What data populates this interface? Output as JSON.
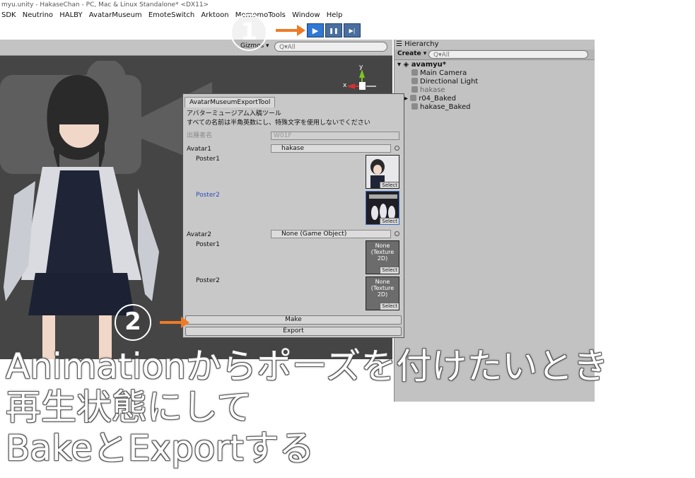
{
  "window": {
    "title": "myu.unity - HakaseChan - PC, Mac & Linux Standalone* <DX11>"
  },
  "menu": [
    "SDK",
    "Neutrino",
    "HALBY",
    "AvatarMuseum",
    "EmoteSwitch",
    "Arktoon",
    "MomomoTools",
    "Window",
    "Help"
  ],
  "playbar": {
    "play_icon": "play-icon",
    "pause_icon": "pause-icon",
    "step_icon": "step-icon",
    "play_glyph": "▶",
    "pause_glyph": "❚❚",
    "step_glyph": "▶|"
  },
  "scene": {
    "gizmos_label": "Gizmos ▾",
    "search_placeholder": "Q▾All",
    "axis_y": "y",
    "axis_x": "x"
  },
  "hierarchy": {
    "tab_label": "Hierarchy",
    "create_label": "Create ▾",
    "search_placeholder": "Q▾All",
    "scene_name": "avamyu*",
    "items": [
      {
        "label": "Main Camera",
        "active": true
      },
      {
        "label": "Directional Light",
        "active": true
      },
      {
        "label": "hakase",
        "active": false
      },
      {
        "label": "r04_Baked",
        "active": true
      },
      {
        "label": "hakase_Baked",
        "active": true
      }
    ]
  },
  "tool": {
    "tab_label": "AvatarMuseumExportTool",
    "heading1": "アバターミュージアム入稿ツール",
    "heading2": "すべての名前は半角英数にし、特殊文字を使用しないでください",
    "exhibitor_label": "出展者名",
    "exhibitor_value": "W01F",
    "avatar1_label": "Avatar1",
    "avatar1_value": "hakase",
    "poster1_label": "Poster1",
    "poster2_label": "Poster2",
    "avatar2_label": "Avatar2",
    "avatar2_value": "None (Game Object)",
    "poster_none_text": "None (Texture 2D)",
    "select_label": "Select",
    "make_label": "Make",
    "export_label": "Export"
  },
  "annotations": {
    "step1": "1",
    "step2": "2",
    "caption_line1": "Animationからポーズを付けたいとき",
    "caption_line2": "再生状態にして",
    "caption_line3": "BakeとExportする",
    "arrow_color": "#ef7a26"
  }
}
